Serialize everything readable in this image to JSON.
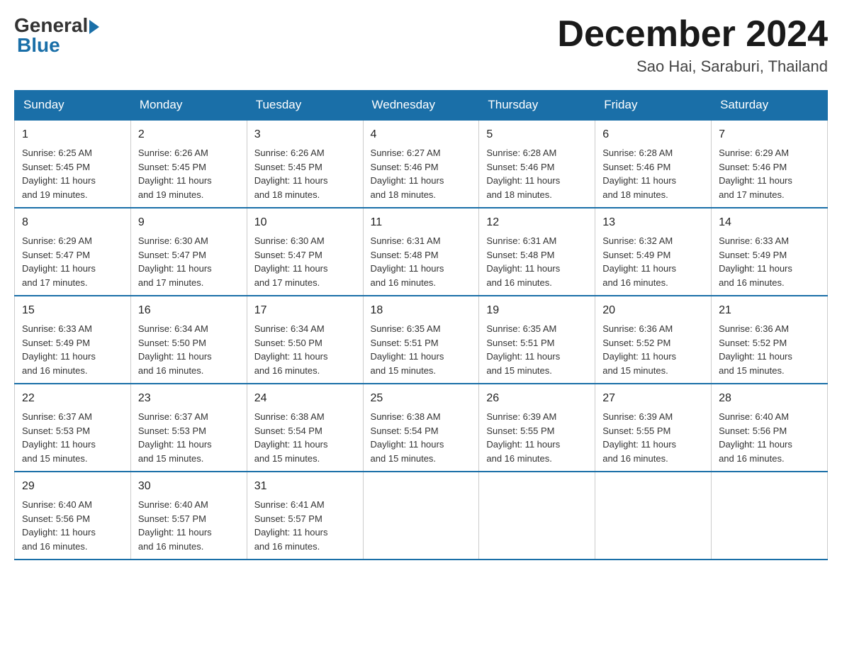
{
  "header": {
    "logo_general": "General",
    "logo_blue": "Blue",
    "month_title": "December 2024",
    "location": "Sao Hai, Saraburi, Thailand"
  },
  "weekdays": [
    "Sunday",
    "Monday",
    "Tuesday",
    "Wednesday",
    "Thursday",
    "Friday",
    "Saturday"
  ],
  "weeks": [
    [
      {
        "day": "1",
        "sunrise": "Sunrise: 6:25 AM",
        "sunset": "Sunset: 5:45 PM",
        "daylight": "Daylight: 11 hours",
        "daylight2": "and 19 minutes."
      },
      {
        "day": "2",
        "sunrise": "Sunrise: 6:26 AM",
        "sunset": "Sunset: 5:45 PM",
        "daylight": "Daylight: 11 hours",
        "daylight2": "and 19 minutes."
      },
      {
        "day": "3",
        "sunrise": "Sunrise: 6:26 AM",
        "sunset": "Sunset: 5:45 PM",
        "daylight": "Daylight: 11 hours",
        "daylight2": "and 18 minutes."
      },
      {
        "day": "4",
        "sunrise": "Sunrise: 6:27 AM",
        "sunset": "Sunset: 5:46 PM",
        "daylight": "Daylight: 11 hours",
        "daylight2": "and 18 minutes."
      },
      {
        "day": "5",
        "sunrise": "Sunrise: 6:28 AM",
        "sunset": "Sunset: 5:46 PM",
        "daylight": "Daylight: 11 hours",
        "daylight2": "and 18 minutes."
      },
      {
        "day": "6",
        "sunrise": "Sunrise: 6:28 AM",
        "sunset": "Sunset: 5:46 PM",
        "daylight": "Daylight: 11 hours",
        "daylight2": "and 18 minutes."
      },
      {
        "day": "7",
        "sunrise": "Sunrise: 6:29 AM",
        "sunset": "Sunset: 5:46 PM",
        "daylight": "Daylight: 11 hours",
        "daylight2": "and 17 minutes."
      }
    ],
    [
      {
        "day": "8",
        "sunrise": "Sunrise: 6:29 AM",
        "sunset": "Sunset: 5:47 PM",
        "daylight": "Daylight: 11 hours",
        "daylight2": "and 17 minutes."
      },
      {
        "day": "9",
        "sunrise": "Sunrise: 6:30 AM",
        "sunset": "Sunset: 5:47 PM",
        "daylight": "Daylight: 11 hours",
        "daylight2": "and 17 minutes."
      },
      {
        "day": "10",
        "sunrise": "Sunrise: 6:30 AM",
        "sunset": "Sunset: 5:47 PM",
        "daylight": "Daylight: 11 hours",
        "daylight2": "and 17 minutes."
      },
      {
        "day": "11",
        "sunrise": "Sunrise: 6:31 AM",
        "sunset": "Sunset: 5:48 PM",
        "daylight": "Daylight: 11 hours",
        "daylight2": "and 16 minutes."
      },
      {
        "day": "12",
        "sunrise": "Sunrise: 6:31 AM",
        "sunset": "Sunset: 5:48 PM",
        "daylight": "Daylight: 11 hours",
        "daylight2": "and 16 minutes."
      },
      {
        "day": "13",
        "sunrise": "Sunrise: 6:32 AM",
        "sunset": "Sunset: 5:49 PM",
        "daylight": "Daylight: 11 hours",
        "daylight2": "and 16 minutes."
      },
      {
        "day": "14",
        "sunrise": "Sunrise: 6:33 AM",
        "sunset": "Sunset: 5:49 PM",
        "daylight": "Daylight: 11 hours",
        "daylight2": "and 16 minutes."
      }
    ],
    [
      {
        "day": "15",
        "sunrise": "Sunrise: 6:33 AM",
        "sunset": "Sunset: 5:49 PM",
        "daylight": "Daylight: 11 hours",
        "daylight2": "and 16 minutes."
      },
      {
        "day": "16",
        "sunrise": "Sunrise: 6:34 AM",
        "sunset": "Sunset: 5:50 PM",
        "daylight": "Daylight: 11 hours",
        "daylight2": "and 16 minutes."
      },
      {
        "day": "17",
        "sunrise": "Sunrise: 6:34 AM",
        "sunset": "Sunset: 5:50 PM",
        "daylight": "Daylight: 11 hours",
        "daylight2": "and 16 minutes."
      },
      {
        "day": "18",
        "sunrise": "Sunrise: 6:35 AM",
        "sunset": "Sunset: 5:51 PM",
        "daylight": "Daylight: 11 hours",
        "daylight2": "and 15 minutes."
      },
      {
        "day": "19",
        "sunrise": "Sunrise: 6:35 AM",
        "sunset": "Sunset: 5:51 PM",
        "daylight": "Daylight: 11 hours",
        "daylight2": "and 15 minutes."
      },
      {
        "day": "20",
        "sunrise": "Sunrise: 6:36 AM",
        "sunset": "Sunset: 5:52 PM",
        "daylight": "Daylight: 11 hours",
        "daylight2": "and 15 minutes."
      },
      {
        "day": "21",
        "sunrise": "Sunrise: 6:36 AM",
        "sunset": "Sunset: 5:52 PM",
        "daylight": "Daylight: 11 hours",
        "daylight2": "and 15 minutes."
      }
    ],
    [
      {
        "day": "22",
        "sunrise": "Sunrise: 6:37 AM",
        "sunset": "Sunset: 5:53 PM",
        "daylight": "Daylight: 11 hours",
        "daylight2": "and 15 minutes."
      },
      {
        "day": "23",
        "sunrise": "Sunrise: 6:37 AM",
        "sunset": "Sunset: 5:53 PM",
        "daylight": "Daylight: 11 hours",
        "daylight2": "and 15 minutes."
      },
      {
        "day": "24",
        "sunrise": "Sunrise: 6:38 AM",
        "sunset": "Sunset: 5:54 PM",
        "daylight": "Daylight: 11 hours",
        "daylight2": "and 15 minutes."
      },
      {
        "day": "25",
        "sunrise": "Sunrise: 6:38 AM",
        "sunset": "Sunset: 5:54 PM",
        "daylight": "Daylight: 11 hours",
        "daylight2": "and 15 minutes."
      },
      {
        "day": "26",
        "sunrise": "Sunrise: 6:39 AM",
        "sunset": "Sunset: 5:55 PM",
        "daylight": "Daylight: 11 hours",
        "daylight2": "and 16 minutes."
      },
      {
        "day": "27",
        "sunrise": "Sunrise: 6:39 AM",
        "sunset": "Sunset: 5:55 PM",
        "daylight": "Daylight: 11 hours",
        "daylight2": "and 16 minutes."
      },
      {
        "day": "28",
        "sunrise": "Sunrise: 6:40 AM",
        "sunset": "Sunset: 5:56 PM",
        "daylight": "Daylight: 11 hours",
        "daylight2": "and 16 minutes."
      }
    ],
    [
      {
        "day": "29",
        "sunrise": "Sunrise: 6:40 AM",
        "sunset": "Sunset: 5:56 PM",
        "daylight": "Daylight: 11 hours",
        "daylight2": "and 16 minutes."
      },
      {
        "day": "30",
        "sunrise": "Sunrise: 6:40 AM",
        "sunset": "Sunset: 5:57 PM",
        "daylight": "Daylight: 11 hours",
        "daylight2": "and 16 minutes."
      },
      {
        "day": "31",
        "sunrise": "Sunrise: 6:41 AM",
        "sunset": "Sunset: 5:57 PM",
        "daylight": "Daylight: 11 hours",
        "daylight2": "and 16 minutes."
      },
      null,
      null,
      null,
      null
    ]
  ]
}
